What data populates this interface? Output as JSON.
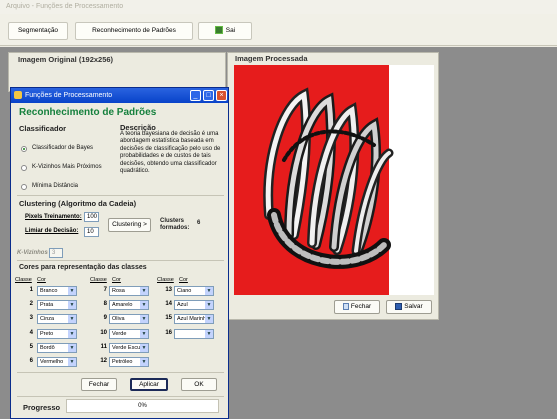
{
  "window": {
    "title": "Arquivo - Funções de Processamento"
  },
  "toolbar": {
    "segmentacao": "Segmentação",
    "reconhecimento": "Reconhecimento de Padrões",
    "sair": "Sai"
  },
  "panels": {
    "original_title": "Imagem Original (192x256)",
    "processed_title": "Imagem Processada",
    "fechar": "Fechar",
    "salvar": "Salvar"
  },
  "dialog": {
    "title": "Funções de Processamento",
    "heading": "Reconhecimento de Padrões",
    "classificador_title": "Classificador",
    "classifiers": [
      {
        "label": "Classificador de Bayes",
        "selected": true
      },
      {
        "label": "K-Vizinhos Mais Próximos",
        "selected": false
      },
      {
        "label": "Mínima Distância",
        "selected": false
      }
    ],
    "descricao_title": "Descrição",
    "descricao_text": "A teoria bayesiana de decisão é uma abordagem estatística baseada em decisões de classificação pelo uso de probabilidades e de custos de tais decisões, obtendo uma classificador quadrático.",
    "clustering_title": "Clustering (Algoritmo da Cadeia)",
    "pixels_label": "Pixels Treinamento:",
    "pixels_value": "100",
    "limiar_label": "Limiar de Decisão:",
    "limiar_value": "10",
    "clustering_button": "Clustering >",
    "clusters_label": "Clusters formados:",
    "clusters_value": "6",
    "kvizinhos_label": "K-Vizinhos",
    "kvizinhos_value": "3",
    "cores_title": "Cores para representação das classes",
    "col_classe": "Classe",
    "col_cor": "Cor",
    "classes": [
      {
        "n": "1",
        "color": "Branco"
      },
      {
        "n": "2",
        "color": "Prata"
      },
      {
        "n": "3",
        "color": "Cinza"
      },
      {
        "n": "4",
        "color": "Preto"
      },
      {
        "n": "5",
        "color": "Bordô"
      },
      {
        "n": "6",
        "color": "Vermelho"
      },
      {
        "n": "7",
        "color": "Rosa"
      },
      {
        "n": "8",
        "color": "Amarelo"
      },
      {
        "n": "9",
        "color": "Oliva"
      },
      {
        "n": "10",
        "color": "Verde"
      },
      {
        "n": "11",
        "color": "Verde Escuro"
      },
      {
        "n": "12",
        "color": "Petróleo"
      },
      {
        "n": "13",
        "color": "Ciano"
      },
      {
        "n": "14",
        "color": "Azul"
      },
      {
        "n": "15",
        "color": "Azul Marinho"
      },
      {
        "n": "16",
        "color": ""
      }
    ],
    "fechar": "Fechar",
    "aplicar": "Aplicar",
    "ok": "OK",
    "progresso_label": "Progresso",
    "progresso_value": "0%"
  },
  "colors": {
    "heading": "#15803d",
    "titlebar": "#0843c9",
    "processed_red": "#e61c1c",
    "workspace": "#8c8c8c"
  }
}
